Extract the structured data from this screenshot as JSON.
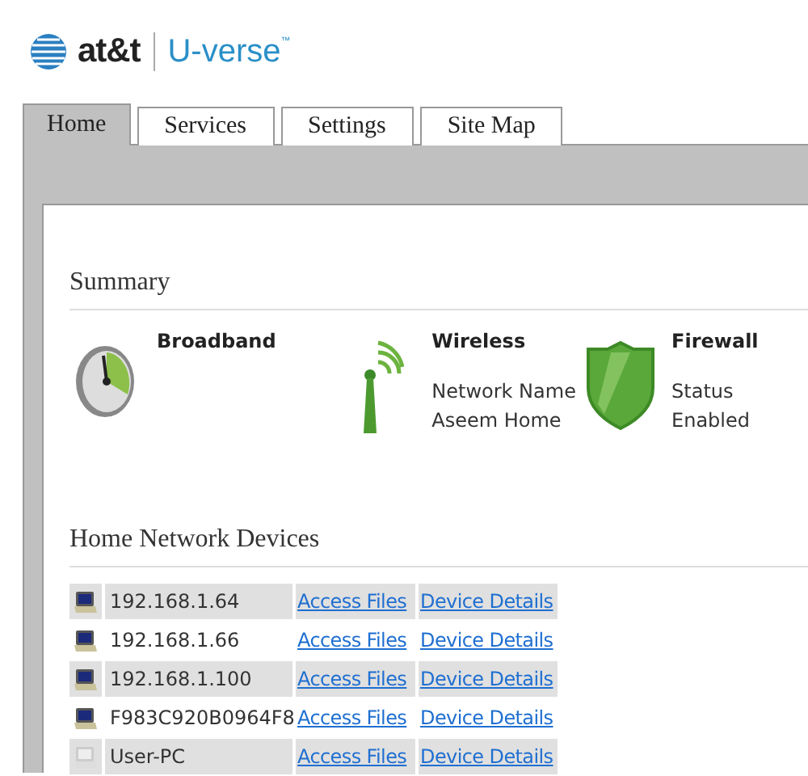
{
  "logo": {
    "brand": "at&t",
    "product": "U-verse",
    "mark": "™"
  },
  "tabs": [
    {
      "label": "Home",
      "selected": true
    },
    {
      "label": "Services",
      "selected": false
    },
    {
      "label": "Settings",
      "selected": false
    },
    {
      "label": "Site Map",
      "selected": false
    }
  ],
  "summary": {
    "title": "Summary",
    "items": [
      {
        "kind": "broadband",
        "title": "Broadband"
      },
      {
        "kind": "wireless",
        "title": "Wireless",
        "lines": [
          "Network Name",
          "Aseem Home"
        ]
      },
      {
        "kind": "firewall",
        "title": "Firewall",
        "lines": [
          "Status",
          "Enabled"
        ]
      }
    ]
  },
  "devices": {
    "title": "Home Network Devices",
    "rows": [
      {
        "name": "192.168.1.64",
        "active": true,
        "links": [
          "Access Files",
          "Device Details"
        ]
      },
      {
        "name": "192.168.1.66",
        "active": true,
        "links": [
          "Access Files",
          "Device Details"
        ]
      },
      {
        "name": "192.168.1.100",
        "active": true,
        "links": [
          "Access Files",
          "Device Details"
        ]
      },
      {
        "name": "F983C920B0964F8",
        "active": true,
        "links": [
          "Access Files",
          "Device Details"
        ]
      },
      {
        "name": "User-PC",
        "active": false,
        "links": [
          "Access Files",
          "Device Details"
        ]
      }
    ]
  }
}
